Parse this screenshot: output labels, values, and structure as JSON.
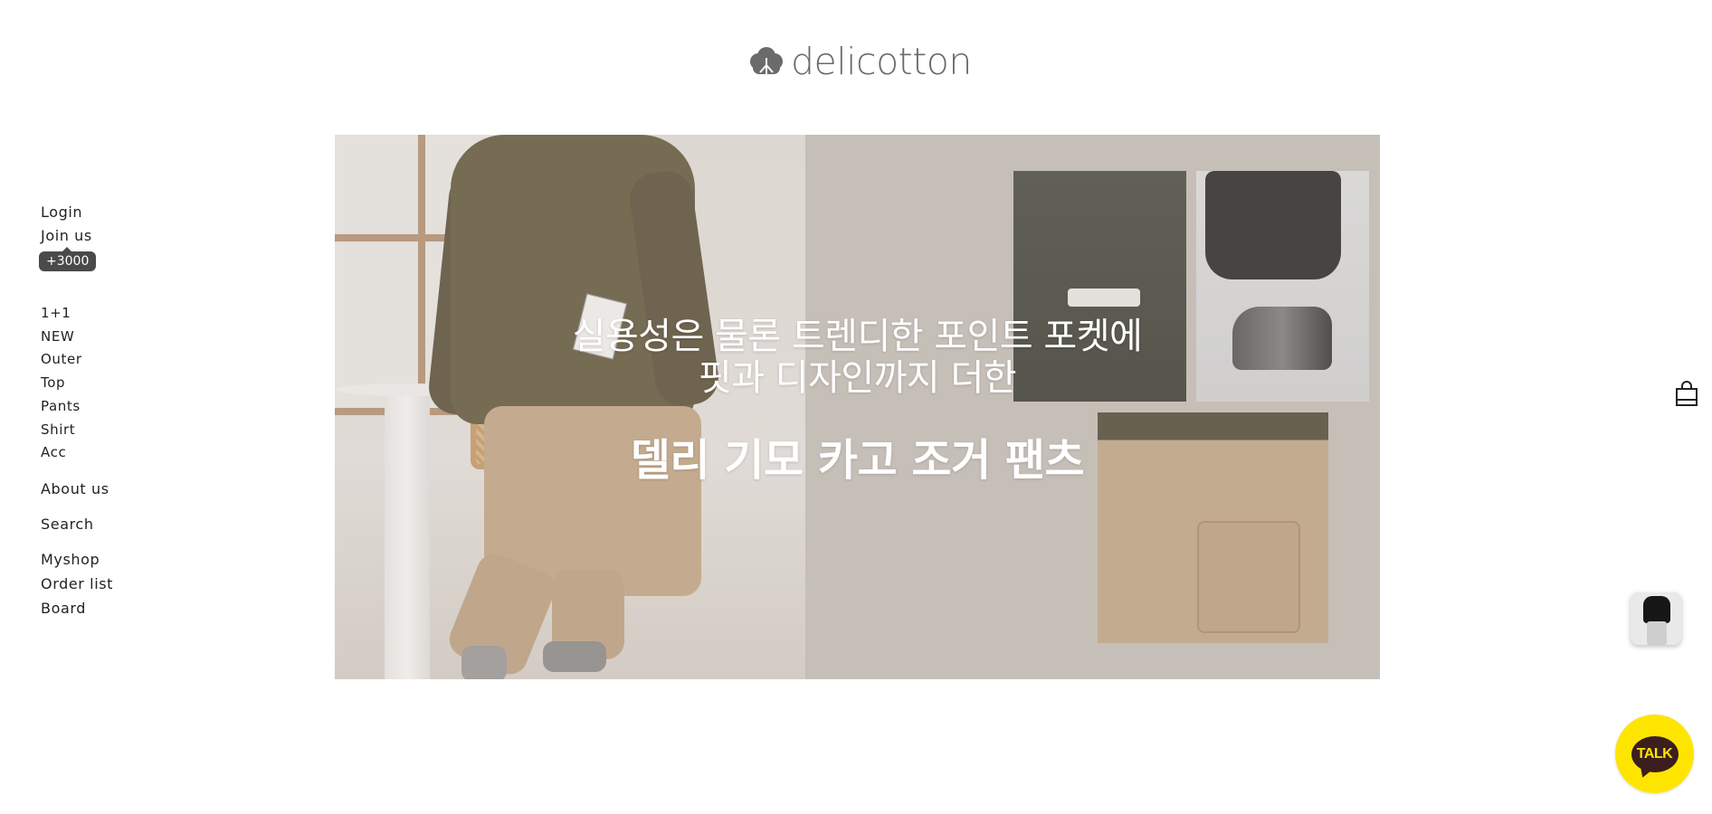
{
  "logo": {
    "text": "delicotton",
    "icon": "cotton-logo-icon"
  },
  "sidebar": {
    "account": [
      {
        "label": "Login"
      },
      {
        "label": "Join us"
      }
    ],
    "badge": "+3000",
    "categories": [
      {
        "label": "1+1"
      },
      {
        "label": "NEW"
      },
      {
        "label": "Outer"
      },
      {
        "label": "Top"
      },
      {
        "label": "Pants"
      },
      {
        "label": "Shirt"
      },
      {
        "label": "Acc"
      }
    ],
    "about": "About us",
    "search": "Search",
    "my": [
      {
        "label": "Myshop"
      },
      {
        "label": "Order list"
      },
      {
        "label": "Board"
      }
    ]
  },
  "hero": {
    "line1": "실용성은 물론 트렌디한 포인트 포켓에",
    "line2": "핏과 디자인까지 더한",
    "title": "델리 기모 카고 조거 팬츠"
  },
  "floating": {
    "cart_icon": "shopping-bag-icon",
    "talk_label": "TALK"
  },
  "colors": {
    "talk_yellow": "#fee500",
    "talk_brown": "#3c1e1e",
    "badge_bg": "#4a4a4a",
    "logo_gray": "#6b6b6b"
  }
}
